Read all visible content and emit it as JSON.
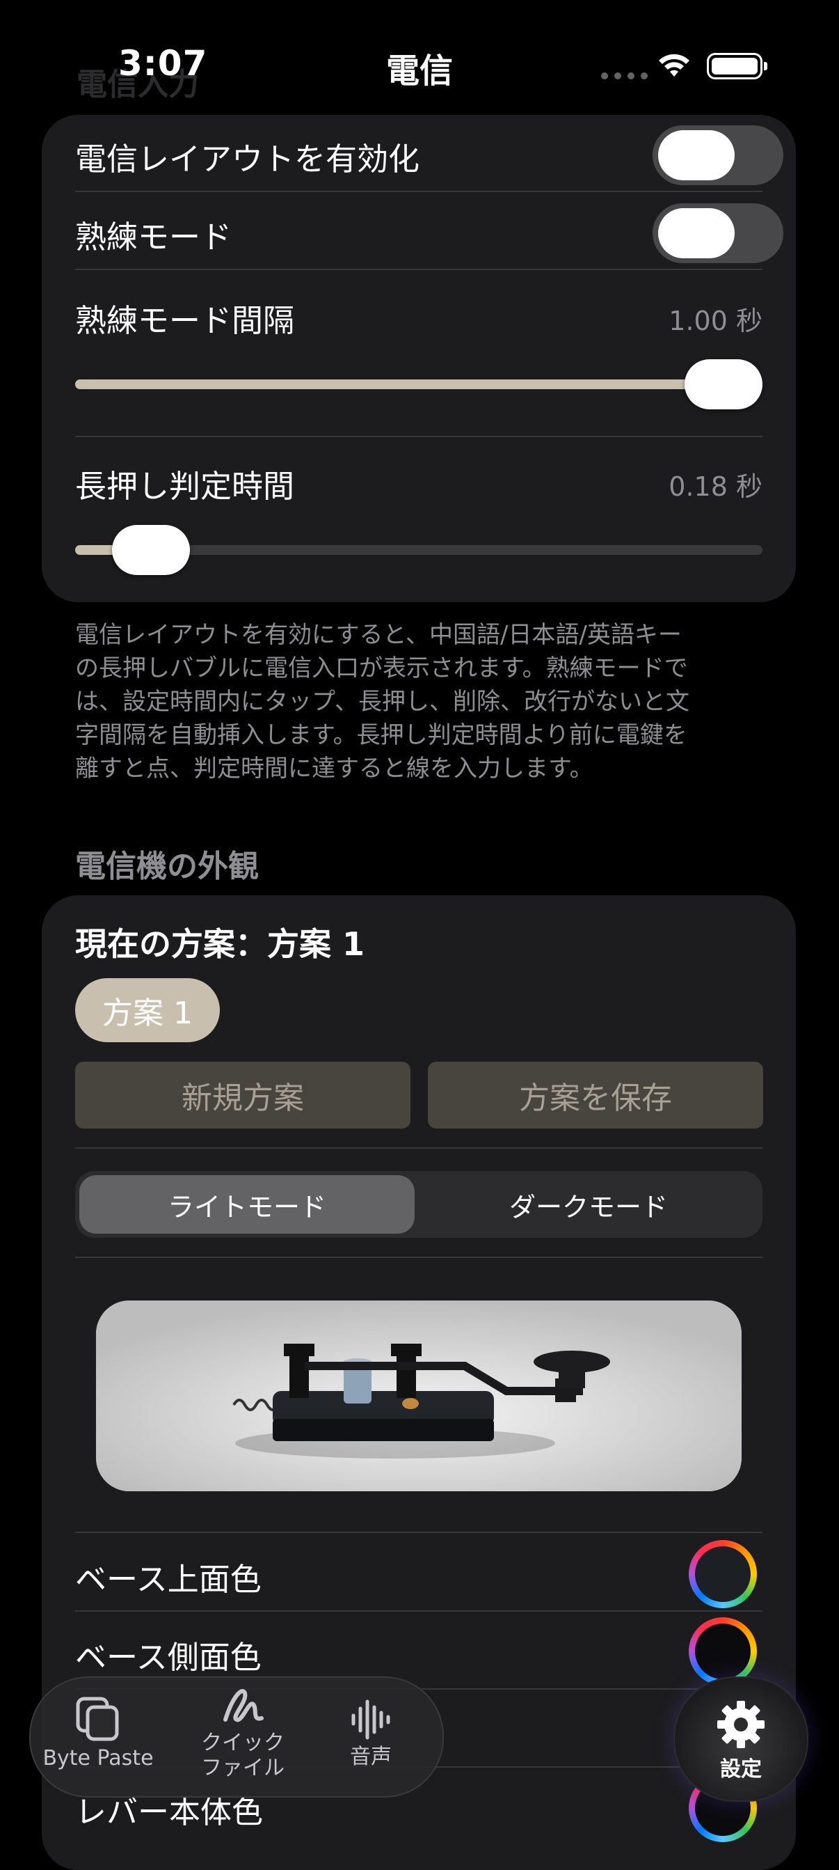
{
  "status_bar": {
    "time": "3:07"
  },
  "nav": {
    "title": "電信",
    "ghost_header": "電信入力"
  },
  "input_section": {
    "rows": [
      {
        "label": "電信レイアウトを有効化",
        "enabled": false
      },
      {
        "label": "熟練モード",
        "enabled": false
      }
    ],
    "sliders": [
      {
        "label": "熟練モード間隔",
        "value_text": "1.00 秒",
        "fraction": 1.0
      },
      {
        "label": "長押し判定時間",
        "value_text": "0.18 秒",
        "fraction": 0.06
      }
    ],
    "description": [
      "電信レイアウトを有効にすると、中国語/日本語/英語キー",
      "の長押しバブルに電信入口が表示されます。熟練モードで",
      "は、設定時間内にタップ、長押し、削除、改行がないと文",
      "字間隔を自動挿入します。長押し判定時間より前に電鍵を",
      "離すと点、判定時間に達すると線を入力します。"
    ]
  },
  "appearance": {
    "section_title": "電信機の外観",
    "current_scheme": "現在の方案：方案 1",
    "scheme_chip": "方案 1",
    "new_scheme_button": "新規方案",
    "save_scheme_button": "方案を保存",
    "segments": {
      "light": "ライトモード",
      "dark": "ダークモード",
      "selected": "light"
    },
    "color_rows": [
      {
        "label": "ベース上面色",
        "color": "#1c1f24"
      },
      {
        "label": "ベース側面色",
        "color": "#0b0b0d"
      },
      {
        "label": "",
        "color": "#141416"
      },
      {
        "label": "レバー本体色",
        "color": "#0b0b0d"
      }
    ]
  },
  "tab_bar": {
    "items": [
      {
        "label": "Byte Paste",
        "icon": "copy-icon"
      },
      {
        "label": "クイック\nファイル",
        "icon": "squiggle-icon"
      },
      {
        "label": "音声",
        "icon": "waveform-icon"
      }
    ],
    "settings": {
      "label": "設定",
      "icon": "gear-icon"
    }
  },
  "colors": {
    "accent": "#c9bfae",
    "card": "#1c1c1e",
    "background": "#000000"
  }
}
